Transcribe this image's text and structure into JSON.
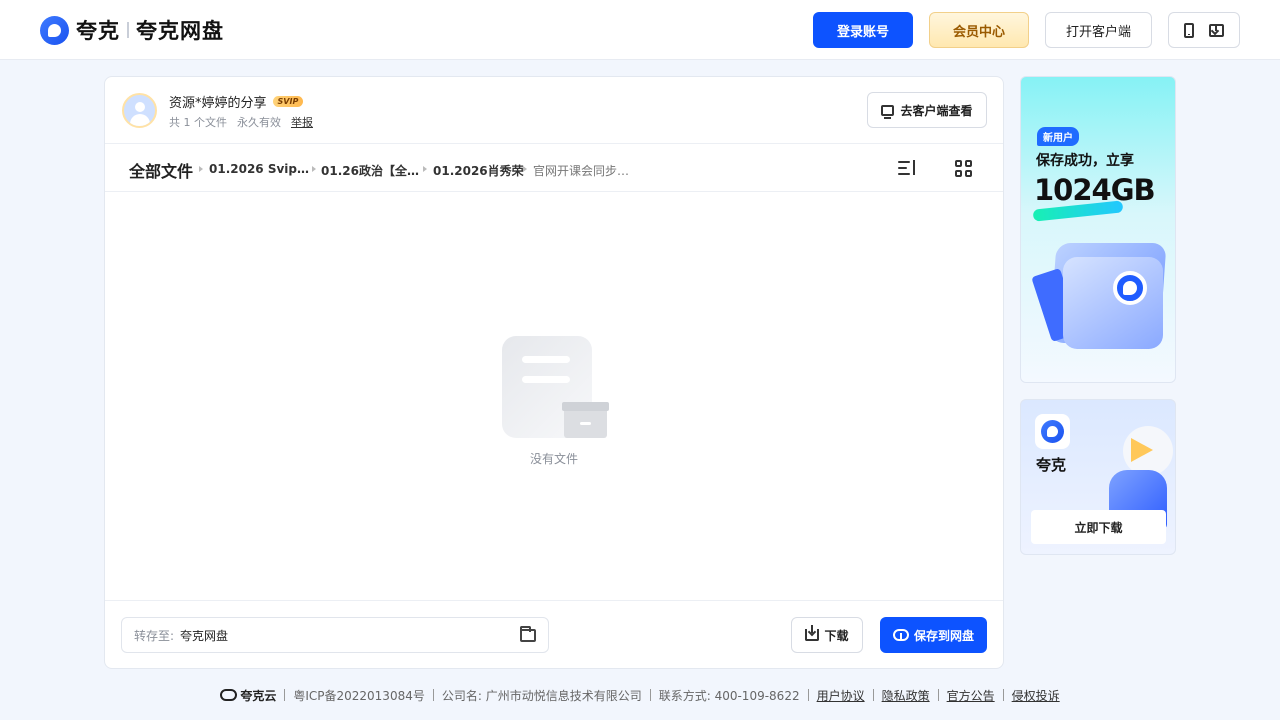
{
  "header": {
    "brand_name": "夸克",
    "product_name": "夸克网盘",
    "login_label": "登录账号",
    "vip_label": "会员中心",
    "open_client_label": "打开客户端"
  },
  "share": {
    "sharer": "资源*婷婷的分享",
    "badge": "SVIP",
    "file_count": "共 1 个文件",
    "validity": "永久有效",
    "report": "举报",
    "client_view_label": "去客户端查看"
  },
  "breadcrumb": {
    "root": "全部文件",
    "items": [
      "01.2026 Svip…",
      "01.26政治【全…",
      "01.2026肖秀荣",
      "官网开课会同步…"
    ]
  },
  "empty": {
    "text": "没有文件"
  },
  "actions": {
    "save_to_label": "转存至:",
    "save_to_value": "夸克网盘",
    "download_label": "下载",
    "save_label": "保存到网盘"
  },
  "ads": {
    "new_user_badge": "新用户",
    "promo_title": "保存成功，立享",
    "promo_amount": "1024GB",
    "app_name": "夸克",
    "download_now": "立即下载"
  },
  "footer": {
    "brand": "夸克云",
    "icp": "粤ICP备2022013084号",
    "company": "公司名: 广州市动悦信息技术有限公司",
    "contact": "联系方式: 400-109-8622",
    "links": [
      "用户协议",
      "隐私政策",
      "官方公告",
      "侵权投诉"
    ]
  },
  "colors": {
    "primary": "#0d53ff",
    "vip_gold": "#9a5a00",
    "page_bg": "#f2f6fd"
  }
}
